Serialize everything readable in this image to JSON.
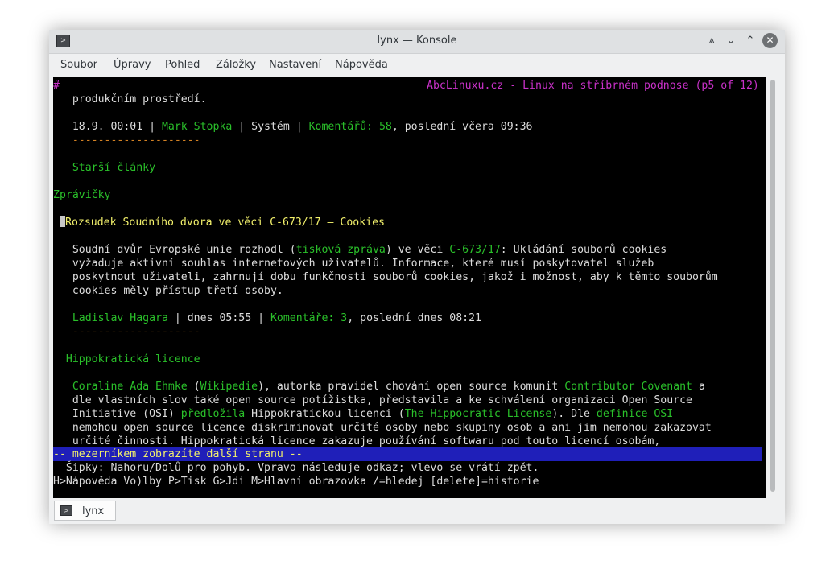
{
  "window": {
    "title": "lynx — Konsole",
    "controls": {
      "keep_above_icon": "⩓",
      "minimize_icon": "⌄",
      "maximize_icon": "⌃",
      "close_icon": "✕"
    }
  },
  "app_icon_glyph": ">",
  "menu": [
    "Soubor",
    "Úpravy",
    "Pohled",
    "Záložky",
    "Nastavení",
    "Nápověda"
  ],
  "terminal": {
    "line1_hash": "#",
    "line1_title": "AbcLinuxu.cz - Linux na stříbrném podnose (p5 of 12)",
    "l2": "   produkčním prostředí.",
    "meta1": {
      "date": "   18.9. 00:01 | ",
      "author": "Mark Stopka",
      "sep1": " | Systém | ",
      "comments": "Komentářů: 58",
      "rest": ", poslední včera 09:36"
    },
    "rule1": "   --------------------",
    "older": "   Starší články",
    "news_heading": "Zprávičky",
    "item1_title": "Rozsudek Soudního dvora ve věci C-673/17 – Cookies",
    "body1": {
      "a": "   Soudní dvůr Evropské unie rozhodl (",
      "link1": "tisková zpráva",
      "b": ") ve věci ",
      "link2": "C-673/17",
      "c": ": Ukládání souborů cookies",
      "l2": "   vyžaduje aktivní souhlas internetových uživatelů. Informace, které musí poskytovatel služeb",
      "l3": "   poskytnout uživateli, zahrnují dobu funkčnosti souborů cookies, jakož i možnost, aby k těmto souborům",
      "l4": "   cookies měly přístup třetí osoby."
    },
    "meta2": {
      "author": "   Ladislav Hagara",
      "sep": " | dnes 05:55 | ",
      "comments": "Komentáře: 3",
      "rest": ", poslední dnes 08:21"
    },
    "rule2": "   --------------------",
    "item2_title": "  Hippokratická licence",
    "body2": {
      "l1_link1": "   Coraline Ada Ehmke",
      "l1_a": " (",
      "l1_link2": "Wikipedie",
      "l1_b": "), autorka pravidel chování open source komunit ",
      "l1_link3": "Contributor Covenant",
      "l1_c": " a",
      "l2": "   dle vlastních slov také open source potížistka, představila a ke schválení organizaci Open Source",
      "l3_a": "   Initiative (OSI) ",
      "l3_link1": "předložila",
      "l3_b": " Hippokratickou licenci (",
      "l3_link2": "The Hippocratic License",
      "l3_c": "). Dle ",
      "l3_link3": "definice OSI",
      "l4": "   nemohou open source licence diskriminovat určité osoby nebo skupiny osob a ani jim nemohou zakazovat",
      "l5": "   určité činnosti. Hippokratická licence zakazuje používání softwaru pod touto licencí osobám,"
    },
    "status_bar": "-- mezerníkem zobrazíte další stranu --",
    "help1": "  Šipky: Nahoru/Dolů pro pohyb. Vpravo následuje odkaz; vlevo se vrátí zpět.",
    "help2": "H>Nápověda Vo)lby P>Tisk G>Jdi M>Hlavní obrazovka /=hledej [delete]=historie"
  },
  "tab": {
    "label": "lynx",
    "icon_glyph": ">"
  },
  "colors": {
    "terminal_bg": "#000000",
    "text": "#dcdcdc",
    "link": "#2ac02a",
    "title": "#c931c9",
    "heading": "#f2f06b",
    "rule": "#d48224",
    "status_bar_bg": "#1f1fb9"
  }
}
